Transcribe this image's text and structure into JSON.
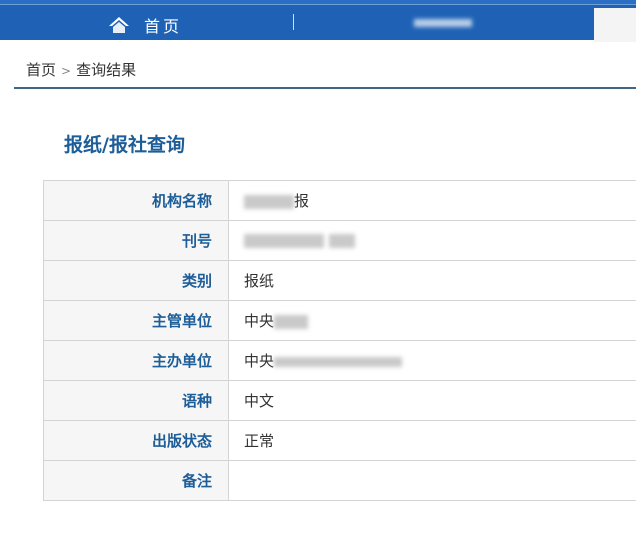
{
  "header": {
    "home_label": "首页"
  },
  "breadcrumb": {
    "home": "首页",
    "separator": ">",
    "current": "查询结果"
  },
  "title": "报纸/报社查询",
  "rows": [
    {
      "label": "机构名称",
      "value": "报"
    },
    {
      "label": "刊号",
      "value": ""
    },
    {
      "label": "类别",
      "value": "报纸"
    },
    {
      "label": "主管单位",
      "value": "中央"
    },
    {
      "label": "主办单位",
      "value": "中央"
    },
    {
      "label": "语种",
      "value": "中文"
    },
    {
      "label": "出版状态",
      "value": "正常"
    },
    {
      "label": "备注",
      "value": ""
    }
  ]
}
